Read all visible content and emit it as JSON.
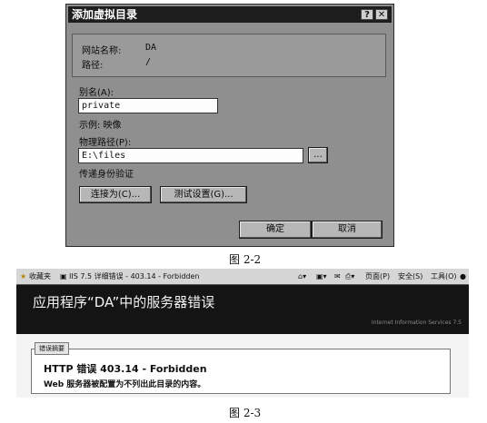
{
  "dialog": {
    "title": "添加虚拟目录",
    "help_btn": "?",
    "close_btn": "✕",
    "site_name_label": "网站名称:",
    "site_name_value": "DA",
    "path_label": "路径:",
    "path_value": "/",
    "alias_label": "别名(A):",
    "alias_value": "private",
    "example_label": "示例: 映像",
    "physical_path_label": "物理路径(P):",
    "physical_path_value": "E:\\files",
    "browse_label": "...",
    "passthrough_label": "传递身份验证",
    "connect_as_label": "连接为(C)...",
    "test_settings_label": "测试设置(G)...",
    "ok_label": "确定",
    "cancel_label": "取消"
  },
  "captions": {
    "fig_2_2": "图 2-2",
    "fig_2_3": "图 2-3"
  },
  "browser": {
    "favorites": "收藏夹",
    "tab_title": "IIS 7.5 详细错误 - 403.14 - Forbidden",
    "page_menu": "页面(P)",
    "safety_menu": "安全(S)",
    "tools_menu": "工具(O)",
    "error_heading": "应用程序“DA”中的服务器错误",
    "iis_tag": "Internet Information Services 7.5",
    "summary_tab": "错误摘要",
    "error_code": "HTTP 错误 403.14 - Forbidden",
    "error_desc": "Web 服务器被配置为不列出此目录的内容。"
  }
}
